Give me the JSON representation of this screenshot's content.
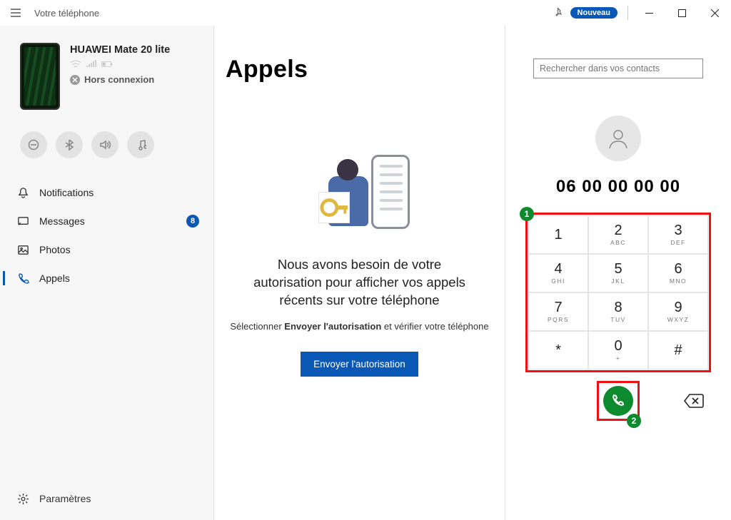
{
  "app": {
    "title": "Votre téléphone",
    "badge": "Nouveau"
  },
  "phone": {
    "name": "HUAWEI Mate 20 lite",
    "status": "Hors connexion"
  },
  "nav": {
    "notifications": "Notifications",
    "messages": "Messages",
    "messages_count": "8",
    "photos": "Photos",
    "appels": "Appels",
    "settings": "Paramètres"
  },
  "center": {
    "heading": "Appels",
    "perm_title": "Nous avons besoin de votre autorisation pour afficher vos appels récents sur votre téléphone",
    "perm_sub_pre": "Sélectionner ",
    "perm_sub_bold": "Envoyer l'autorisation",
    "perm_sub_post": " et vérifier votre téléphone",
    "button": "Envoyer l'autorisation"
  },
  "dialer": {
    "search_placeholder": "Rechercher dans vos contacts",
    "number": "06 00 00 00 00",
    "keys": [
      {
        "d": "1",
        "l": ""
      },
      {
        "d": "2",
        "l": "ABC"
      },
      {
        "d": "3",
        "l": "DEF"
      },
      {
        "d": "4",
        "l": "GHI"
      },
      {
        "d": "5",
        "l": "JKL"
      },
      {
        "d": "6",
        "l": "MNO"
      },
      {
        "d": "7",
        "l": "PQRS"
      },
      {
        "d": "8",
        "l": "TUV"
      },
      {
        "d": "9",
        "l": "WXYZ"
      },
      {
        "d": "*",
        "l": ""
      },
      {
        "d": "0",
        "l": "+"
      },
      {
        "d": "#",
        "l": ""
      }
    ],
    "anno1": "1",
    "anno2": "2"
  }
}
